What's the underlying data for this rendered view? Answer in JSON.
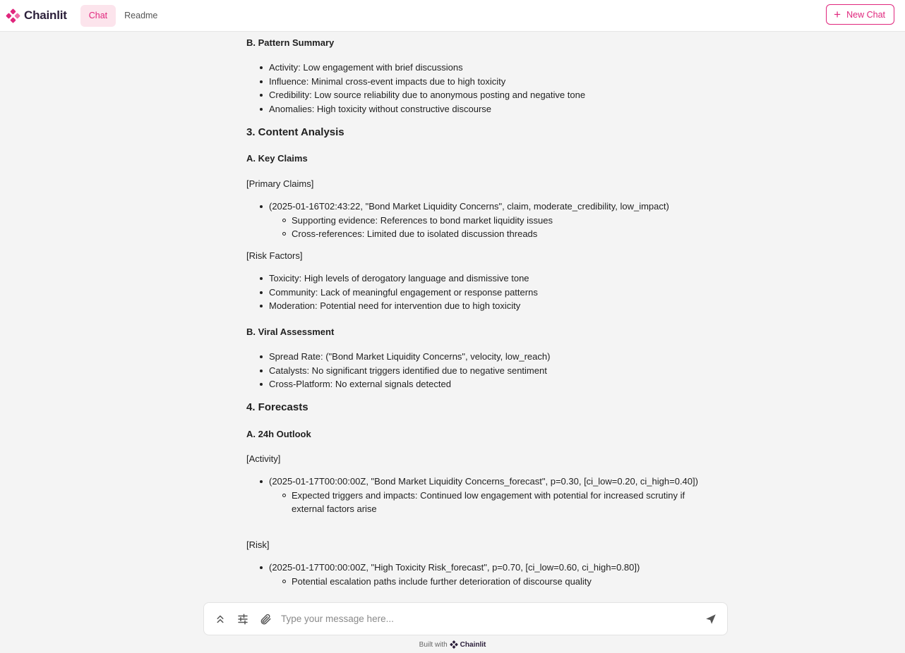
{
  "app": {
    "brand": "Chainlit",
    "accent": "#e0267d"
  },
  "header": {
    "tabs": [
      {
        "label": "Chat",
        "active": true
      },
      {
        "label": "Readme",
        "active": false
      }
    ],
    "new_chat_label": "New Chat"
  },
  "message": {
    "pattern_summary_heading": "B. Pattern Summary",
    "pattern_summary_items": [
      "Activity: Low engagement with brief discussions",
      "Influence: Minimal cross-event impacts due to high toxicity",
      "Credibility: Low source reliability due to anonymous posting and negative tone",
      "Anomalies: High toxicity without constructive discourse"
    ],
    "content_analysis_heading": "3. Content Analysis",
    "key_claims_heading": "A. Key Claims",
    "primary_claims_label": "[Primary Claims]",
    "primary_claim": "(2025-01-16T02:43:22, \"Bond Market Liquidity Concerns\", claim, moderate_credibility, low_impact)",
    "primary_claim_sub": [
      "Supporting evidence: References to bond market liquidity issues",
      "Cross-references: Limited due to isolated discussion threads"
    ],
    "risk_factors_label": "[Risk Factors]",
    "risk_factors": [
      "Toxicity: High levels of derogatory language and dismissive tone",
      "Community: Lack of meaningful engagement or response patterns",
      "Moderation: Potential need for intervention due to high toxicity"
    ],
    "viral_heading": "B. Viral Assessment",
    "viral_items": [
      "Spread Rate: (\"Bond Market Liquidity Concerns\", velocity, low_reach)",
      "Catalysts: No significant triggers identified due to negative sentiment",
      "Cross-Platform: No external signals detected"
    ],
    "forecasts_heading": "4. Forecasts",
    "outlook_heading": "A. 24h Outlook",
    "activity_label": "[Activity]",
    "activity_forecast": "(2025-01-17T00:00:00Z, \"Bond Market Liquidity Concerns_forecast\", p=0.30, [ci_low=0.20, ci_high=0.40])",
    "activity_sub": "Expected triggers and impacts: Continued low engagement with potential for increased scrutiny if external factors arise",
    "risk_label": "[Risk]",
    "risk_forecast": "(2025-01-17T00:00:00Z, \"High Toxicity Risk_forecast\", p=0.70, [ci_low=0.60, ci_high=0.80])",
    "risk_sub": "Potential escalation paths include further deterioration of discourse quality"
  },
  "composer": {
    "placeholder": "Type your message here...",
    "icons": [
      "chevrons-up-icon",
      "settings-sliders-icon",
      "paperclip-icon",
      "send-icon"
    ]
  },
  "footer": {
    "built_with": "Built with",
    "brand": "Chainlit"
  }
}
